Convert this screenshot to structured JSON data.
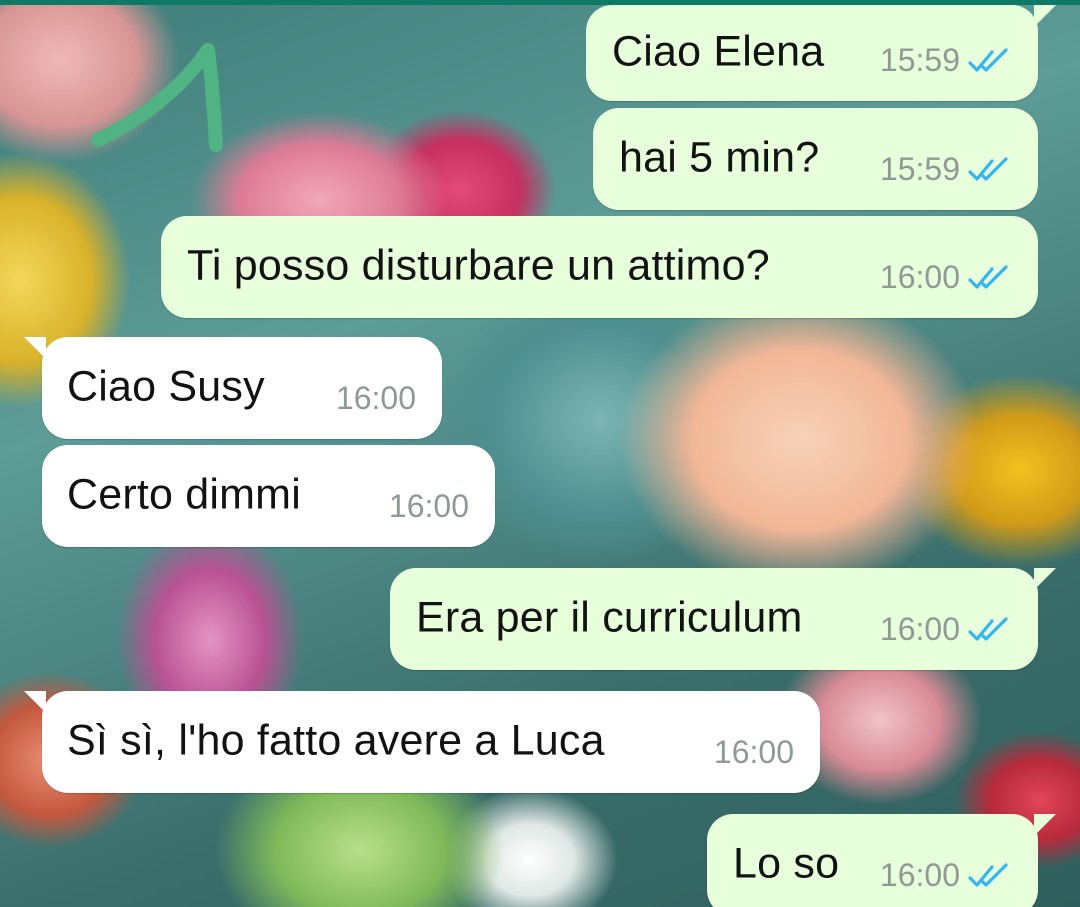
{
  "chat": {
    "messages": [
      {
        "direction": "outgoing",
        "text": "Ciao Elena",
        "time": "15:59",
        "status": "read"
      },
      {
        "direction": "outgoing",
        "text": "hai 5 min?",
        "time": "15:59",
        "status": "read"
      },
      {
        "direction": "outgoing",
        "text": "Ti posso disturbare un attimo?",
        "time": "16:00",
        "status": "read"
      },
      {
        "direction": "incoming",
        "text": "Ciao Susy",
        "time": "16:00"
      },
      {
        "direction": "incoming",
        "text": "Certo dimmi",
        "time": "16:00"
      },
      {
        "direction": "outgoing",
        "text": "Era per il curriculum",
        "time": "16:00",
        "status": "read"
      },
      {
        "direction": "incoming",
        "text": "Sì sì, l'ho fatto avere a Luca",
        "time": "16:00"
      },
      {
        "direction": "outgoing",
        "text": "Lo so",
        "time": "16:00",
        "status": "read"
      }
    ]
  },
  "colors": {
    "outgoing_bubble": "#e7ffdb",
    "incoming_bubble": "#ffffff",
    "read_ticks": "#34b7f1",
    "timestamp": "#8f9a94",
    "annotation_arrow": "#4fb384",
    "top_bar": "#0e7a66"
  },
  "icons": {
    "read_receipt": "double-check-icon",
    "annotation": "hand-drawn-arrow-icon"
  }
}
